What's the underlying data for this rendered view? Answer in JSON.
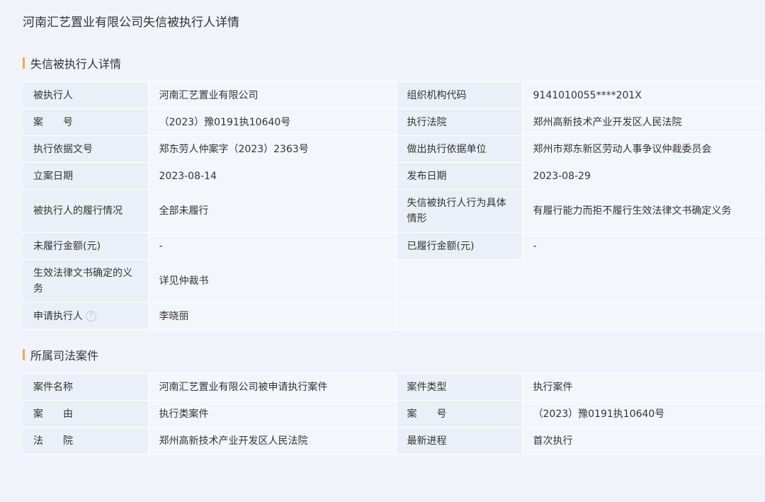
{
  "page": {
    "title": "河南汇艺置业有限公司失信被执行人详情"
  },
  "detail": {
    "title": "失信被执行人详情",
    "rows": [
      {
        "k1": "被执行人",
        "v1": "河南汇艺置业有限公司",
        "k2": "组织机构代码",
        "v2": "9141010055****201X"
      },
      {
        "k1": "案　　号",
        "v1": "（2023）豫0191执10640号",
        "k2": "执行法院",
        "v2": "郑州高新技术产业开发区人民法院"
      },
      {
        "k1": "执行依据文号",
        "v1": "郑东劳人仲案字（2023）2363号",
        "k2": "做出执行依据单位",
        "v2": "郑州市郑东新区劳动人事争议仲裁委员会"
      },
      {
        "k1": "立案日期",
        "v1": "2023-08-14",
        "k2": "发布日期",
        "v2": "2023-08-29"
      },
      {
        "k1": "被执行人的履行情况",
        "v1": "全部未履行",
        "k2": "失信被执行人行为具体情形",
        "v2": "有履行能力而拒不履行生效法律文书确定义务"
      },
      {
        "k1": "未履行金额(元)",
        "v1": "-",
        "k2": "已履行金额(元)",
        "v2": "-"
      },
      {
        "k1": "生效法律文书确定的义务",
        "v1": "详见仲裁书"
      },
      {
        "k1": "申请执行人",
        "v1": "李晓丽"
      }
    ],
    "help_icon": "question-circle-icon",
    "help_glyph": "?"
  },
  "case": {
    "title": "所属司法案件",
    "rows": [
      {
        "k1": "案件名称",
        "v1": "河南汇艺置业有限公司被申请执行案件",
        "k2": "案件类型",
        "v2": "执行案件"
      },
      {
        "k1": "案　　由",
        "v1": "执行类案件",
        "k2": "案　　号",
        "v2": "（2023）豫0191执10640号"
      },
      {
        "k1": "法　　院",
        "v1": "郑州高新技术产业开发区人民法院",
        "k2": "最新进程",
        "v2": "首次执行"
      }
    ]
  },
  "colors": {
    "accent_bar": "#f4a94a",
    "link": "#3a7ed6",
    "key_cell_bg": "#ebf0f8",
    "value_cell_bg": "#f3f6fb",
    "page_bg": "#f0f4fa"
  }
}
